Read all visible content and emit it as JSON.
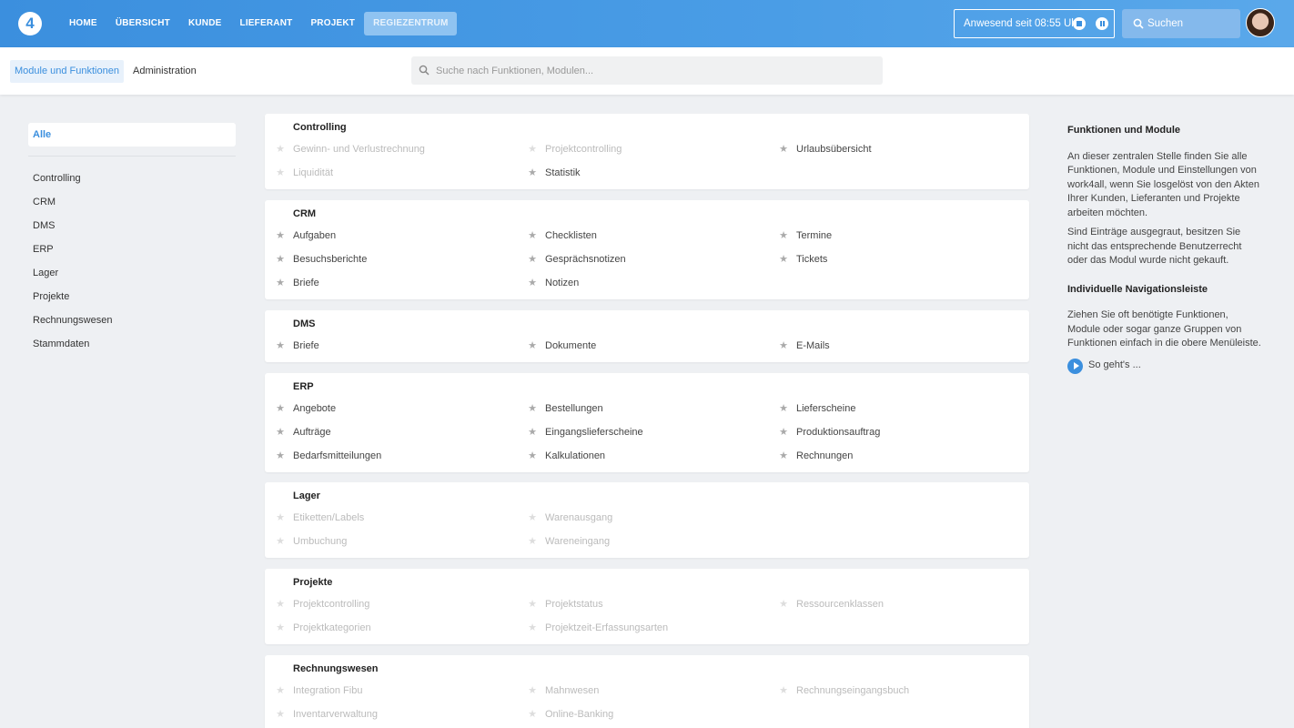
{
  "topbar": {
    "logo": "4",
    "nav": [
      "HOME",
      "ÜBERSICHT",
      "KUNDE",
      "LIEFERANT",
      "PROJEKT",
      "REGIEZENTRUM"
    ],
    "active_nav": "REGIEZENTRUM",
    "attendance": "Anwesend seit 08:55 Uhr",
    "search_label": "Suchen"
  },
  "subbar": {
    "tab_modules": "Module und Funktionen",
    "tab_admin": "Administration",
    "search_placeholder": "Suche nach Funktionen, Modulen..."
  },
  "sidebar": {
    "all": "Alle",
    "items": [
      "Controlling",
      "CRM",
      "DMS",
      "ERP",
      "Lager",
      "Projekte",
      "Rechnungswesen",
      "Stammdaten"
    ]
  },
  "groups": [
    {
      "title": "Controlling",
      "items": [
        {
          "label": "Gewinn- und Verlustrechnung",
          "enabled": false
        },
        {
          "label": "Projektcontrolling",
          "enabled": false
        },
        {
          "label": "Urlaubsübersicht",
          "enabled": true
        },
        {
          "label": "Liquidität",
          "enabled": false
        },
        {
          "label": "Statistik",
          "enabled": true
        }
      ]
    },
    {
      "title": "CRM",
      "items": [
        {
          "label": "Aufgaben",
          "enabled": true
        },
        {
          "label": "Checklisten",
          "enabled": true
        },
        {
          "label": "Termine",
          "enabled": true
        },
        {
          "label": "Besuchsberichte",
          "enabled": true
        },
        {
          "label": "Gesprächsnotizen",
          "enabled": true
        },
        {
          "label": "Tickets",
          "enabled": true
        },
        {
          "label": "Briefe",
          "enabled": true
        },
        {
          "label": "Notizen",
          "enabled": true
        }
      ]
    },
    {
      "title": "DMS",
      "items": [
        {
          "label": "Briefe",
          "enabled": true
        },
        {
          "label": "Dokumente",
          "enabled": true
        },
        {
          "label": "E-Mails",
          "enabled": true
        }
      ]
    },
    {
      "title": "ERP",
      "items": [
        {
          "label": "Angebote",
          "enabled": true
        },
        {
          "label": "Bestellungen",
          "enabled": true
        },
        {
          "label": "Lieferscheine",
          "enabled": true
        },
        {
          "label": "Aufträge",
          "enabled": true
        },
        {
          "label": "Eingangslieferscheine",
          "enabled": true
        },
        {
          "label": "Produktionsauftrag",
          "enabled": true
        },
        {
          "label": "Bedarfsmitteilungen",
          "enabled": true
        },
        {
          "label": "Kalkulationen",
          "enabled": true
        },
        {
          "label": "Rechnungen",
          "enabled": true
        }
      ]
    },
    {
      "title": "Lager",
      "items": [
        {
          "label": "Etiketten/Labels",
          "enabled": false
        },
        {
          "label": "Warenausgang",
          "enabled": false
        },
        {
          "label": "Umbuchung",
          "enabled": false
        },
        {
          "label": "Wareneingang",
          "enabled": false
        }
      ],
      "columns": 2
    },
    {
      "title": "Projekte",
      "items": [
        {
          "label": "Projektcontrolling",
          "enabled": false
        },
        {
          "label": "Projektstatus",
          "enabled": false
        },
        {
          "label": "Ressourcenklassen",
          "enabled": false
        },
        {
          "label": "Projektkategorien",
          "enabled": false
        },
        {
          "label": "Projektzeit-Erfassungsarten",
          "enabled": false
        }
      ]
    },
    {
      "title": "Rechnungswesen",
      "items": [
        {
          "label": "Integration Fibu",
          "enabled": false
        },
        {
          "label": "Mahnwesen",
          "enabled": false
        },
        {
          "label": "Rechnungseingangsbuch",
          "enabled": false
        },
        {
          "label": "Inventarverwaltung",
          "enabled": false
        },
        {
          "label": "Online-Banking",
          "enabled": false
        }
      ]
    }
  ],
  "info": {
    "title1": "Funktionen und Module",
    "p1": "An dieser zentralen Stelle finden Sie alle Funktionen, Module und Einstellungen von work4all, wenn Sie losgelöst von den Akten Ihrer Kunden, Lieferanten und Projekte arbeiten möchten.",
    "p2": "Sind Einträge ausgegraut, besitzen Sie nicht das entsprechende Benutzerrecht oder das Modul wurde nicht gekauft.",
    "title2": "Individuelle Navigationsleiste",
    "p3": "Ziehen Sie oft benötigte Funktionen, Module oder sogar ganze Gruppen von Funktionen einfach in die obere Menüleiste.",
    "howto": "So geht's ..."
  },
  "colors": {
    "accent": "#3b8fde",
    "disabled": "#bbbbbb"
  },
  "icons": {
    "star": "star-icon",
    "search": "search-icon",
    "play": "play-icon",
    "stop": "stop-icon",
    "pause": "pause-icon"
  }
}
